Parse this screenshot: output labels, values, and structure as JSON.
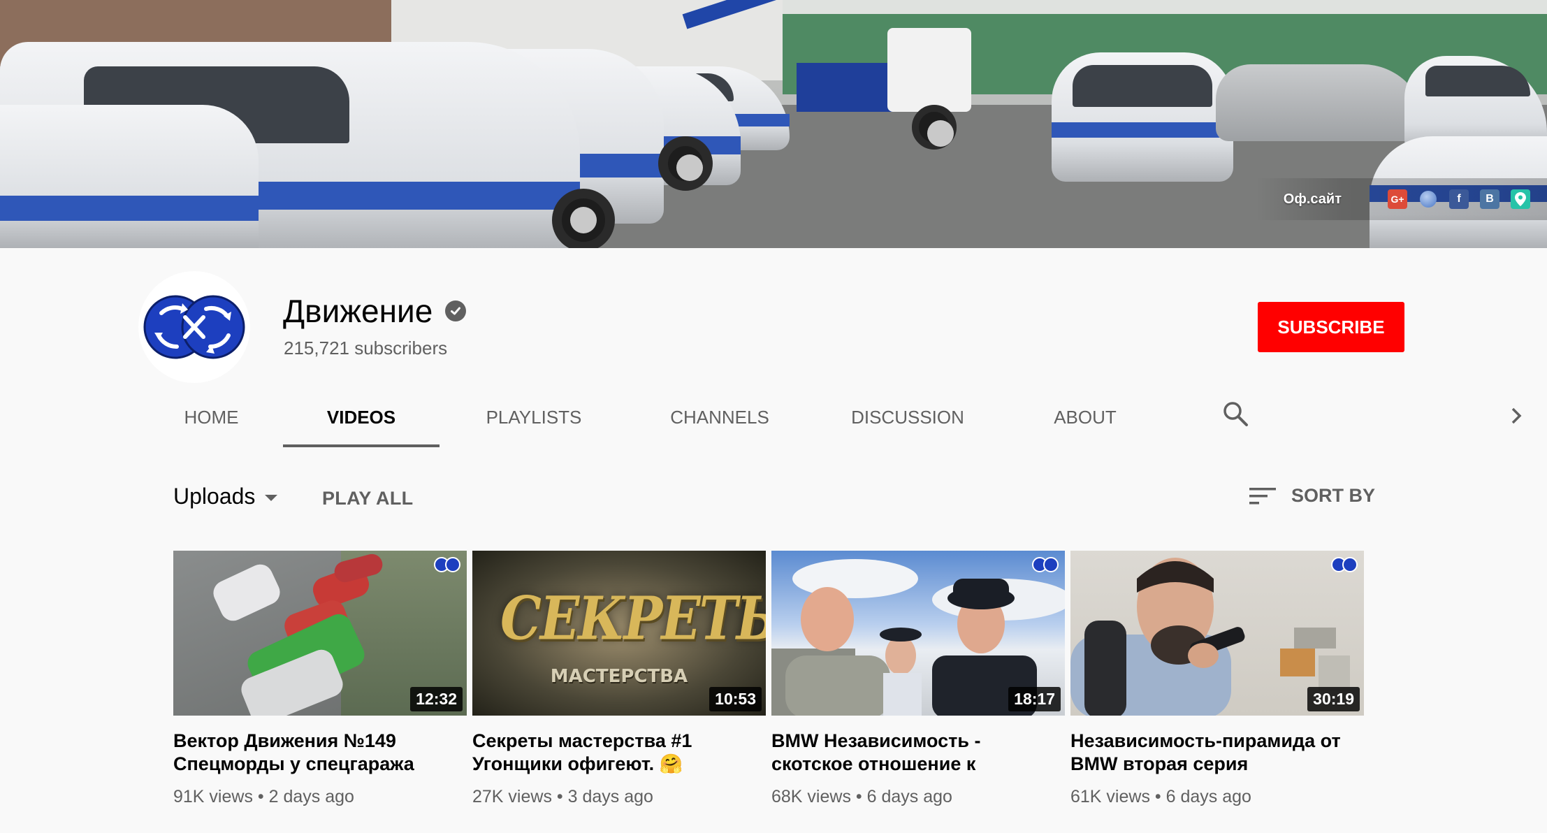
{
  "banner": {
    "site_link": "Оф.сайт",
    "social": [
      {
        "icon": "google-plus-icon",
        "label": "G+",
        "color": "#dd4b39"
      },
      {
        "icon": "globe-icon",
        "label": "",
        "color": "#4a77c5"
      },
      {
        "icon": "facebook-icon",
        "label": "f",
        "color": "#3b5998"
      },
      {
        "icon": "vk-icon",
        "label": "B",
        "color": "#4c75a3"
      },
      {
        "icon": "map-pin-icon",
        "label": "",
        "color": "#27c3a8"
      }
    ]
  },
  "channel": {
    "name": "Движение",
    "verified": true,
    "subscribers": "215,721 subscribers",
    "subscribe_label": "SUBSCRIBE",
    "subscribe_color": "#ff0000"
  },
  "tabs": [
    {
      "label": "HOME",
      "active": false
    },
    {
      "label": "VIDEOS",
      "active": true
    },
    {
      "label": "PLAYLISTS",
      "active": false
    },
    {
      "label": "CHANNELS",
      "active": false
    },
    {
      "label": "DISCUSSION",
      "active": false
    },
    {
      "label": "ABOUT",
      "active": false
    }
  ],
  "toolbar": {
    "uploads_label": "Uploads",
    "play_all_label": "PLAY ALL",
    "sort_label": "SORT BY"
  },
  "videos": [
    {
      "title": "Вектор Движения №149 Спецморды у спецгаража",
      "duration": "12:32",
      "views": "91K views",
      "age": "2 days ago"
    },
    {
      "title": "Секреты мастерства #1 Угонщики офигеют. 🤗",
      "duration": "10:53",
      "views": "27K views",
      "age": "3 days ago",
      "thumb_text_big": "СЕКРЕТЫ",
      "thumb_text_small": "МАСТЕРСТВА"
    },
    {
      "title": "BMW Независимость - скотское отношение к",
      "duration": "18:17",
      "views": "68K views",
      "age": "6 days ago"
    },
    {
      "title": "Независимость-пирамида от BMW вторая серия",
      "duration": "30:19",
      "views": "61K views",
      "age": "6 days ago"
    }
  ],
  "colors": {
    "text_primary": "#030303",
    "text_secondary": "#606060",
    "page_bg": "#f9f9f9"
  }
}
